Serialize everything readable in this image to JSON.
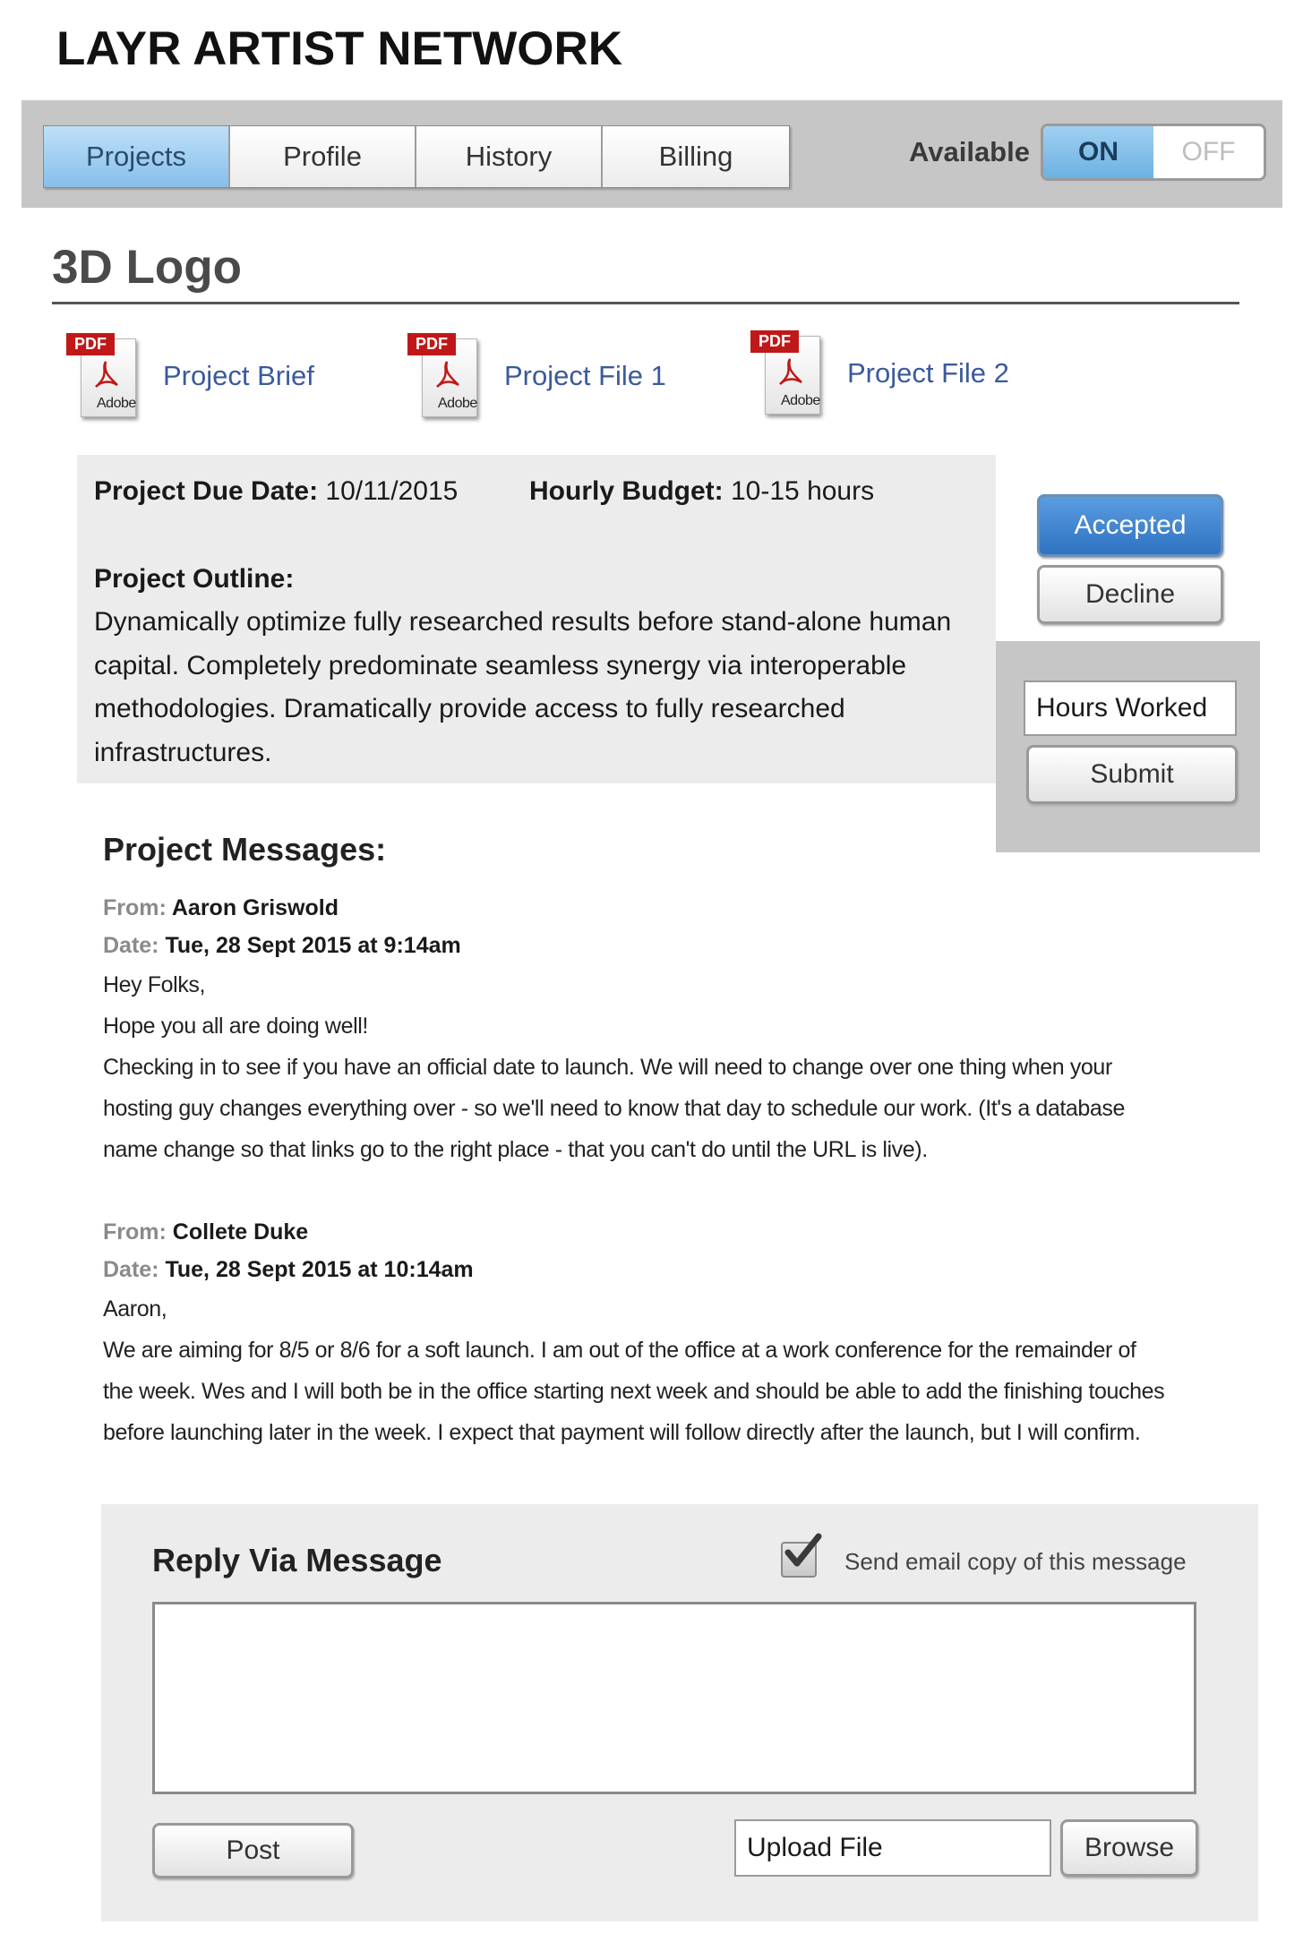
{
  "brand": "LAYR ARTIST NETWORK",
  "nav": {
    "tabs": [
      {
        "label": "Projects",
        "active": true
      },
      {
        "label": "Profile",
        "active": false
      },
      {
        "label": "History",
        "active": false
      },
      {
        "label": "Billing",
        "active": false
      }
    ],
    "available_label": "Available",
    "toggle_on": "ON",
    "toggle_off": "OFF",
    "availability": "ON"
  },
  "project": {
    "title": "3D Logo",
    "files": [
      {
        "label": "Project Brief",
        "icon": "pdf-icon",
        "tag": "PDF",
        "vendor": "Adobe"
      },
      {
        "label": "Project File 1",
        "icon": "pdf-icon",
        "tag": "PDF",
        "vendor": "Adobe"
      },
      {
        "label": "Project File 2",
        "icon": "pdf-icon",
        "tag": "PDF",
        "vendor": "Adobe"
      }
    ],
    "due_date_label": "Project Due Date:",
    "due_date": "10/11/2015",
    "budget_label": "Hourly Budget:",
    "budget": "10-15 hours",
    "outline_label": "Project Outline:",
    "outline": "Dynamically optimize fully researched results before stand-alone human capital. Completely predominate seamless synergy via interoperable methodologies. Dramatically provide access to fully researched infrastructures."
  },
  "actions": {
    "accepted": "Accepted",
    "decline": "Decline",
    "hours_worked": "Hours Worked",
    "submit": "Submit"
  },
  "messages": {
    "title": "Project Messages:",
    "from_label": "From:",
    "date_label": "Date:",
    "items": [
      {
        "from": "Aaron Griswold",
        "date": "Tue, 28 Sept 2015 at 9:14am",
        "lines": [
          "Hey Folks,",
          "Hope you all are doing well!",
          "Checking in to see if you have an official date to launch. We will need to change over one thing when your",
          "hosting guy changes everything over - so we'll need to know that day to schedule our work. (It's a database",
          "name change so that links go to the right place - that you can't do until the URL is live)."
        ]
      },
      {
        "from": "Collete Duke",
        "date": "Tue, 28 Sept 2015 at 10:14am",
        "lines": [
          "Aaron,",
          "We are aiming for 8/5 or 8/6 for a soft launch. I am out of the office at a work conference for the remainder of",
          "the week. Wes and I will both be in the office starting next week and should be able to add the finishing touches",
          "before launching later in the week. I expect that payment will follow directly after the launch, but I will confirm."
        ]
      }
    ]
  },
  "reply": {
    "title": "Reply Via Message",
    "email_copy_label": "Send email copy of this message",
    "email_copy_checked": true,
    "message_value": "",
    "post": "Post",
    "upload_file": "Upload File",
    "browse": "Browse"
  }
}
